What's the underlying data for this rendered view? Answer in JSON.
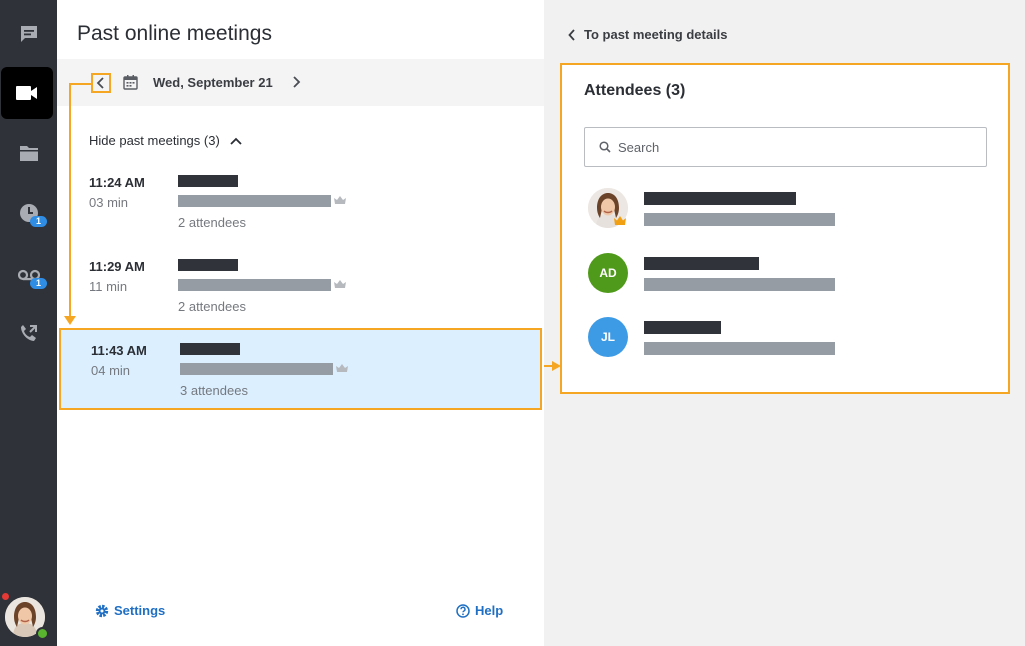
{
  "rail": {
    "items": [
      {
        "name": "chat",
        "icon": "chat-icon"
      },
      {
        "name": "meetings",
        "icon": "video-camera-icon",
        "active": true
      },
      {
        "name": "files",
        "icon": "folder-icon"
      },
      {
        "name": "history",
        "icon": "clock-icon",
        "badge": "1"
      },
      {
        "name": "voicemail",
        "icon": "voicemail-icon",
        "badge": "1"
      },
      {
        "name": "call-forward",
        "icon": "phone-forward-icon"
      }
    ]
  },
  "middle": {
    "title": "Past online meetings",
    "date": "Wed, September 21",
    "hide_toggle": "Hide past meetings (3)",
    "meetings": [
      {
        "time": "11:24 AM",
        "duration": "03 min",
        "attendees": "2 attendees"
      },
      {
        "time": "11:29 AM",
        "duration": "11 min",
        "attendees": "2 attendees"
      },
      {
        "time": "11:43 AM",
        "duration": "04 min",
        "attendees": "3 attendees",
        "selected": true
      }
    ],
    "settings": "Settings",
    "help": "Help"
  },
  "right": {
    "back": "To past meeting details",
    "attendees_title": "Attendees (3)",
    "search_placeholder": "Search",
    "attendees": [
      {
        "initials": "",
        "photo": true,
        "organizer": true
      },
      {
        "initials": "AD",
        "color": "#4f9a1a"
      },
      {
        "initials": "JL",
        "color": "#3d9be6"
      }
    ]
  },
  "colors": {
    "highlight": "#f5a623",
    "selected_row": "#dcefff",
    "link": "#1f6fc4",
    "badge": "#2f8de4"
  }
}
